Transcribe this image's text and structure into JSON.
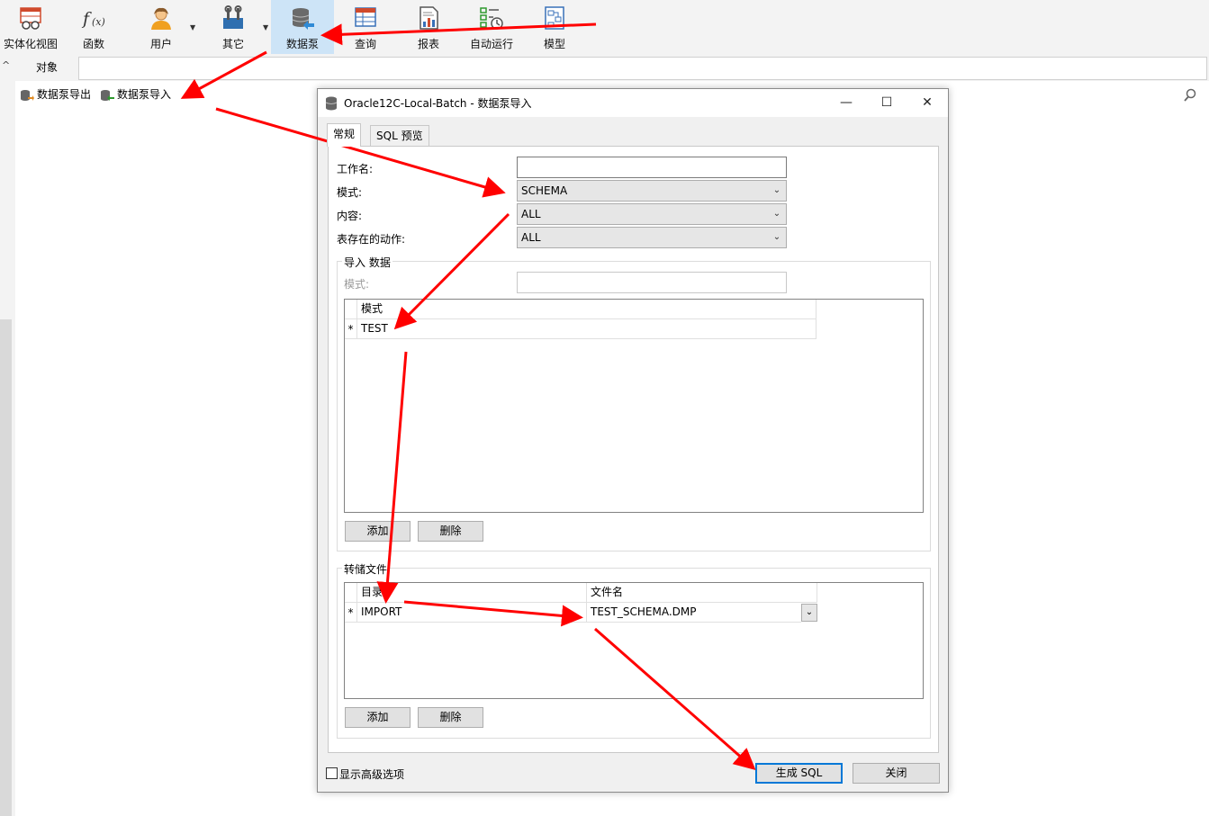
{
  "ribbon": {
    "items": [
      {
        "label": "实体化视图",
        "icon": "materialized-view-icon"
      },
      {
        "label": "函数",
        "icon": "function-icon"
      },
      {
        "label": "用户",
        "icon": "user-icon"
      },
      {
        "label": "其它",
        "icon": "tools-icon"
      },
      {
        "label": "数据泵",
        "icon": "data-pump-icon"
      },
      {
        "label": "查询",
        "icon": "query-icon"
      },
      {
        "label": "报表",
        "icon": "report-icon"
      },
      {
        "label": "自动运行",
        "icon": "automation-icon"
      },
      {
        "label": "模型",
        "icon": "model-icon"
      }
    ],
    "active": "数据泵"
  },
  "object_tab": {
    "label": "对象"
  },
  "toolbar": {
    "export_label": "数据泵导出",
    "import_label": "数据泵导入"
  },
  "dialog": {
    "title": "Oracle12C-Local-Batch - 数据泵导入",
    "tabs": [
      "常规",
      "SQL 预览"
    ],
    "fields": {
      "job_name_label": "工作名:",
      "job_name_value": "",
      "mode_label": "模式:",
      "mode_value": "SCHEMA",
      "content_label": "内容:",
      "content_value": "ALL",
      "table_exists_label": "表存在的动作:",
      "table_exists_value": "ALL"
    },
    "import_data_group": {
      "title": "导入 数据",
      "schema_label": "模式:",
      "schema_value": "",
      "grid_header": "模式",
      "rows": [
        {
          "marker": "*",
          "value": "TEST"
        }
      ],
      "add_label": "添加",
      "delete_label": "删除"
    },
    "dump_file_group": {
      "title": "转储文件",
      "headers": [
        "目录",
        "文件名"
      ],
      "rows": [
        {
          "marker": "*",
          "directory": "IMPORT",
          "filename": "TEST_SCHEMA.DMP"
        }
      ],
      "add_label": "添加",
      "delete_label": "删除"
    },
    "show_advanced_label": "显示高级选项",
    "generate_sql_label": "生成 SQL",
    "close_label": "关闭"
  },
  "colors": {
    "annotation_arrow": "#ff0000",
    "ribbon_active": "#cde4f7",
    "primary_button_border": "#0078d7"
  }
}
